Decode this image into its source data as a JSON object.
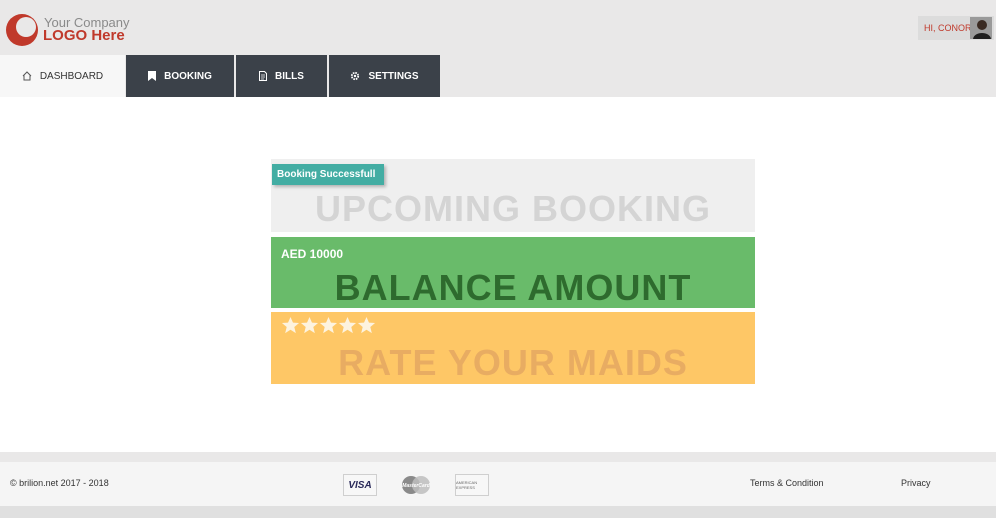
{
  "header": {
    "logo_line1": "Your Company",
    "logo_line2": "LOGO Here",
    "greeting": "HI, CONOR"
  },
  "nav": {
    "tabs": [
      {
        "label": "DASHBOARD",
        "icon": "home-icon",
        "active": true
      },
      {
        "label": "BOOKING",
        "icon": "bookmark-icon",
        "active": false
      },
      {
        "label": "BILLS",
        "icon": "document-icon",
        "active": false
      },
      {
        "label": "SETTINGS",
        "icon": "gear-icon",
        "active": false
      }
    ]
  },
  "cards": {
    "upcoming": {
      "badge": "Booking Successfull",
      "title": "UPCOMING BOOKING"
    },
    "balance": {
      "amount": "AED 10000",
      "title": "BALANCE AMOUNT"
    },
    "rate": {
      "stars": 5,
      "title": "RATE YOUR MAIDS"
    }
  },
  "footer": {
    "copyright": "© brilion.net 2017 - 2018",
    "payment_methods": [
      "VISA",
      "MasterCard",
      "AMERICAN EXPRESS"
    ],
    "terms": "Terms & Condition",
    "privacy": "Privacy"
  },
  "colors": {
    "brand_red": "#c0392b",
    "nav_dark": "#3b4149",
    "badge_teal": "#43ada3",
    "balance_green": "#69bb6a",
    "rate_orange": "#fec766"
  }
}
